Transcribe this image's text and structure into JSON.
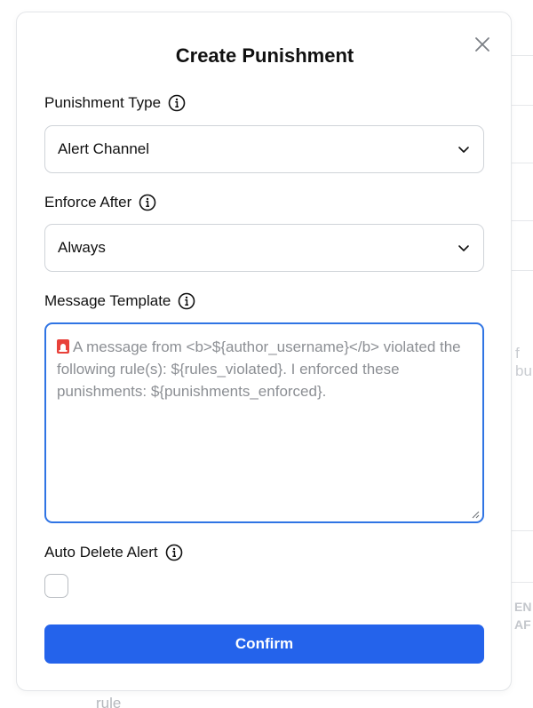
{
  "modal": {
    "title": "Create Punishment",
    "close_icon": "close-icon"
  },
  "fields": {
    "punishment_type": {
      "label": "Punishment Type",
      "value": "Alert Channel"
    },
    "enforce_after": {
      "label": "Enforce After",
      "value": "Always"
    },
    "message_template": {
      "label": "Message Template",
      "placeholder_icon": "siren-emoji",
      "placeholder": "A message from <b>${author_username}</b> violated the following rule(s): ${rules_violated}. I enforced these punishments: ${punishments_enforced}."
    },
    "auto_delete_alert": {
      "label": "Auto Delete Alert",
      "checked": false
    }
  },
  "confirm_label": "Confirm",
  "background": {
    "fragment_text": "f bu",
    "column_header_line1": "EN",
    "column_header_line2": "AF",
    "cell_text": "rule"
  },
  "colors": {
    "primary": "#2463eb",
    "focus_border": "#2f74e4",
    "placeholder_text": "#8c8f94"
  }
}
